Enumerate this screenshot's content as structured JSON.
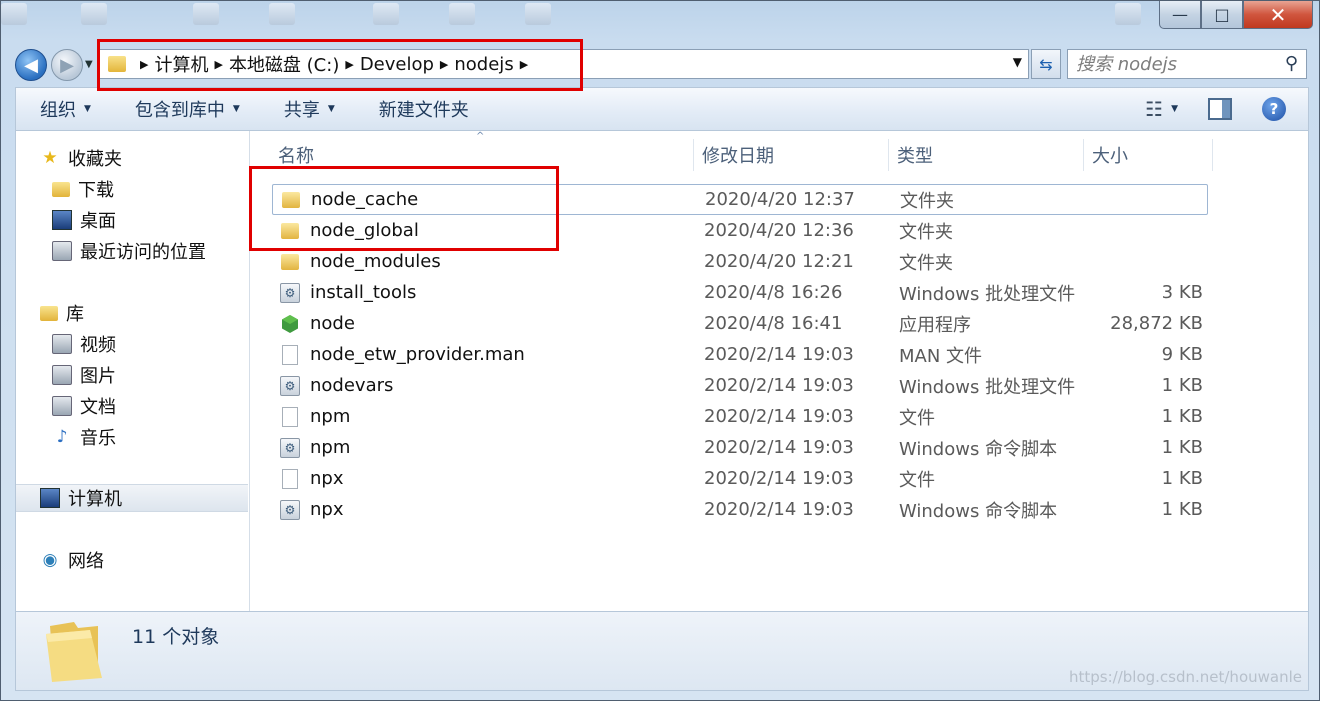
{
  "window": {
    "caption": {
      "minimize": "—",
      "maximize": "□",
      "close": "✕"
    }
  },
  "address": {
    "crumbs": [
      "计算机",
      "本地磁盘 (C:)",
      "Develop",
      "nodejs"
    ],
    "search_placeholder": "搜索 nodejs"
  },
  "toolbar": {
    "organize": "组织",
    "include_library": "包含到库中",
    "share": "共享",
    "new_folder": "新建文件夹"
  },
  "nav": {
    "favorites": "收藏夹",
    "downloads": "下载",
    "desktop": "桌面",
    "recent": "最近访问的位置",
    "libraries": "库",
    "videos": "视频",
    "pictures": "图片",
    "documents": "文档",
    "music": "音乐",
    "computer": "计算机",
    "network": "网络"
  },
  "columns": {
    "name": "名称",
    "date": "修改日期",
    "type": "类型",
    "size": "大小"
  },
  "files": [
    {
      "name": "node_cache",
      "date": "2020/4/20 12:37",
      "type": "文件夹",
      "size": "",
      "icon": "folder-icon"
    },
    {
      "name": "node_global",
      "date": "2020/4/20 12:36",
      "type": "文件夹",
      "size": "",
      "icon": "folder-icon"
    },
    {
      "name": "node_modules",
      "date": "2020/4/20 12:21",
      "type": "文件夹",
      "size": "",
      "icon": "folder-icon"
    },
    {
      "name": "install_tools",
      "date": "2020/4/8 16:26",
      "type": "Windows 批处理文件",
      "size": "3 KB",
      "icon": "batch-file-icon"
    },
    {
      "name": "node",
      "date": "2020/4/8 16:41",
      "type": "应用程序",
      "size": "28,872 KB",
      "icon": "node-app-icon"
    },
    {
      "name": "node_etw_provider.man",
      "date": "2020/2/14 19:03",
      "type": "MAN 文件",
      "size": "9 KB",
      "icon": "file-icon"
    },
    {
      "name": "nodevars",
      "date": "2020/2/14 19:03",
      "type": "Windows 批处理文件",
      "size": "1 KB",
      "icon": "batch-file-icon"
    },
    {
      "name": "npm",
      "date": "2020/2/14 19:03",
      "type": "文件",
      "size": "1 KB",
      "icon": "file-icon"
    },
    {
      "name": "npm",
      "date": "2020/2/14 19:03",
      "type": "Windows 命令脚本",
      "size": "1 KB",
      "icon": "batch-file-icon"
    },
    {
      "name": "npx",
      "date": "2020/2/14 19:03",
      "type": "文件",
      "size": "1 KB",
      "icon": "file-icon"
    },
    {
      "name": "npx",
      "date": "2020/2/14 19:03",
      "type": "Windows 命令脚本",
      "size": "1 KB",
      "icon": "batch-file-icon"
    }
  ],
  "status": {
    "count": "11 个对象"
  },
  "watermark": "https://blog.csdn.net/houwanle",
  "colors": {
    "highlight": "#e00000",
    "accent": "#1e395b"
  }
}
